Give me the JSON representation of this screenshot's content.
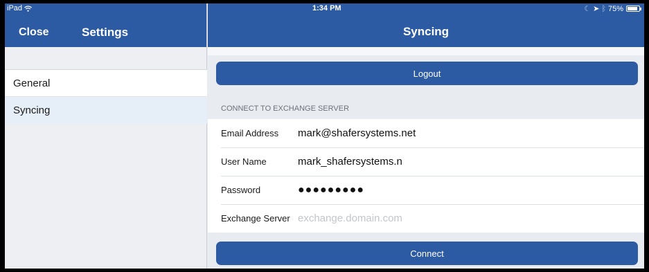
{
  "status_bar": {
    "device": "iPad",
    "time": "1:34 PM",
    "battery_text": "75%",
    "battery_level": 0.75
  },
  "left_nav": {
    "close_label": "Close",
    "title": "Settings",
    "items": [
      {
        "label": "General"
      },
      {
        "label": "Syncing"
      }
    ]
  },
  "right_nav": {
    "title": "Syncing"
  },
  "logout_label": "Logout",
  "section_header": "CONNECT TO EXCHANGE SERVER",
  "form": {
    "email": {
      "label": "Email Address",
      "value": "mark@shafersystems.net"
    },
    "username": {
      "label": "User Name",
      "value": "mark_shafersystems.n"
    },
    "password": {
      "label": "Password",
      "value": "●●●●●●●●●"
    },
    "server": {
      "label": "Exchange Server",
      "value": "",
      "placeholder": "exchange.domain.com"
    }
  },
  "connect_label": "Connect",
  "colors": {
    "nav_blue": "#2d5ba3",
    "selected_row": "#e6eef8",
    "background": "#e8ebef"
  }
}
